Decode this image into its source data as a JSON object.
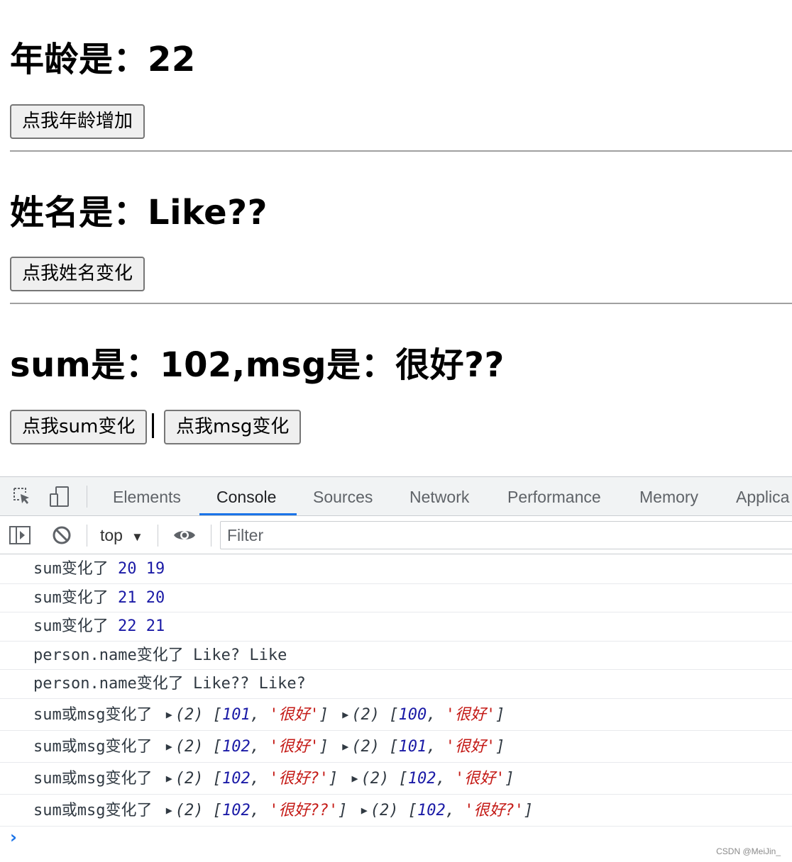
{
  "page": {
    "age_heading": "年龄是：22",
    "age_button": "点我年龄增加",
    "name_heading": "姓名是：Like??",
    "name_button": "点我姓名变化",
    "summsg_heading": "sum是：102,msg是：很好??",
    "sum_button": "点我sum变化",
    "msg_button": "点我msg变化"
  },
  "devtools": {
    "tabs": [
      "Elements",
      "Console",
      "Sources",
      "Network",
      "Performance",
      "Memory",
      "Applica"
    ],
    "active_tab": "Console",
    "context": "top",
    "filter_placeholder": "Filter",
    "icons": [
      "inspect-icon",
      "device-toolbar-icon",
      "sidebar-toggle-icon",
      "clear-console-icon",
      "eye-icon"
    ],
    "accent_color": "#1a73e8"
  },
  "console": {
    "simple_logs": [
      {
        "label": "sum变化了",
        "a": "20",
        "b": "19"
      },
      {
        "label": "sum变化了",
        "a": "21",
        "b": "20"
      },
      {
        "label": "sum变化了",
        "a": "22",
        "b": "21"
      }
    ],
    "text_logs": [
      "person.name变化了 Like? Like",
      "person.name变化了 Like?? Like?"
    ],
    "array_logs": [
      {
        "label": "sum或msg变化了",
        "len1": "(2)",
        "n1": "101",
        "s1": "'很好'",
        "len2": "(2)",
        "n2": "100",
        "s2": "'很好'"
      },
      {
        "label": "sum或msg变化了",
        "len1": "(2)",
        "n1": "102",
        "s1": "'很好'",
        "len2": "(2)",
        "n2": "101",
        "s2": "'很好'"
      },
      {
        "label": "sum或msg变化了",
        "len1": "(2)",
        "n1": "102",
        "s1": "'很好?'",
        "len2": "(2)",
        "n2": "102",
        "s2": "'很好'"
      },
      {
        "label": "sum或msg变化了",
        "len1": "(2)",
        "n1": "102",
        "s1": "'很好??'",
        "len2": "(2)",
        "n2": "102",
        "s2": "'很好?'"
      }
    ],
    "prompt": "›"
  },
  "watermark": "CSDN @MeiJin_"
}
